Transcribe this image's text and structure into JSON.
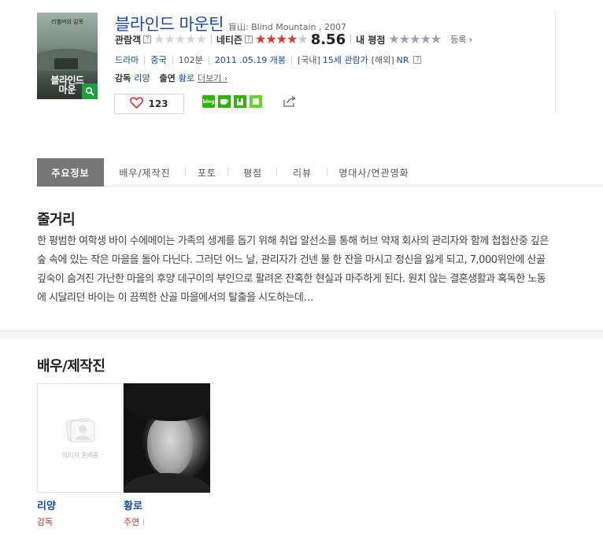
{
  "movie": {
    "title": "블라인드 마운틴",
    "subtitle": "盲山: Blind Mountain , 2007",
    "poster": {
      "top_text": "리멤버의 길목",
      "title_line1": "블라인드",
      "title_line2": "마운"
    }
  },
  "ratings": {
    "audience_label": "관람객",
    "netizen_label": "네티즌",
    "netizen_score": "8.56",
    "netizen_stars": "★★★★",
    "netizen_half": "★",
    "empty_stars5": "★★★★★",
    "my_label": "내 평점",
    "enroll_label": "등록 ›",
    "help": "?"
  },
  "info": {
    "genre": "드라마",
    "country": "중국",
    "runtime": "102분",
    "release": "2011 .05.19 개봉",
    "domestic_label": "[국내]",
    "domestic_rating": "15세 관람가",
    "overseas_label": "[해외]",
    "overseas_rating": "NR"
  },
  "people": {
    "director_label": "감독",
    "director": "리양",
    "cast_label": "출연",
    "cast": "황로",
    "more": "더보기 ›"
  },
  "like": {
    "count": "123"
  },
  "tabs": [
    {
      "label": "주요정보"
    },
    {
      "label": "배우/제작진"
    },
    {
      "label": "포토"
    },
    {
      "label": "평점"
    },
    {
      "label": "리뷰"
    },
    {
      "label": "명대사/연관영화"
    }
  ],
  "synopsis": {
    "heading": "줄거리",
    "text": "한 평범한 여학생 바이 수에메이는 가족의 생계를 돕기 위해 취업 알선소를 통해 허브 약재 회사의 관리자와 함께 첩첩산중 깊은 숲 속에 있는 작은 마을을 돌아 다닌다. 그러던 어느 날, 관리자가 건넨 물 한 잔을 마시고 정신을 잃게 되고, 7,000위안에 산골 깊숙이 숨겨진 가난한 마을의 후양 데구이의 부인으로 팔려온 잔혹한 현실과 마주하게 된다. 원치 않는 결혼생활과 혹독한 노동에 시달리던 바이는 이 끔찍한 산골 마을에서의 탈출을 시도하는데…"
  },
  "cast_section": {
    "heading": "배우/제작진",
    "placeholder_text": "이미지 준비중",
    "members": [
      {
        "name": "리양",
        "role": "감독"
      },
      {
        "name": "황로",
        "role": "주연"
      }
    ]
  },
  "colors": {
    "link": "#1a4aa5",
    "netizen_star": "#e5302f",
    "active_tab": "#777777",
    "naver_green": "#2db400"
  }
}
